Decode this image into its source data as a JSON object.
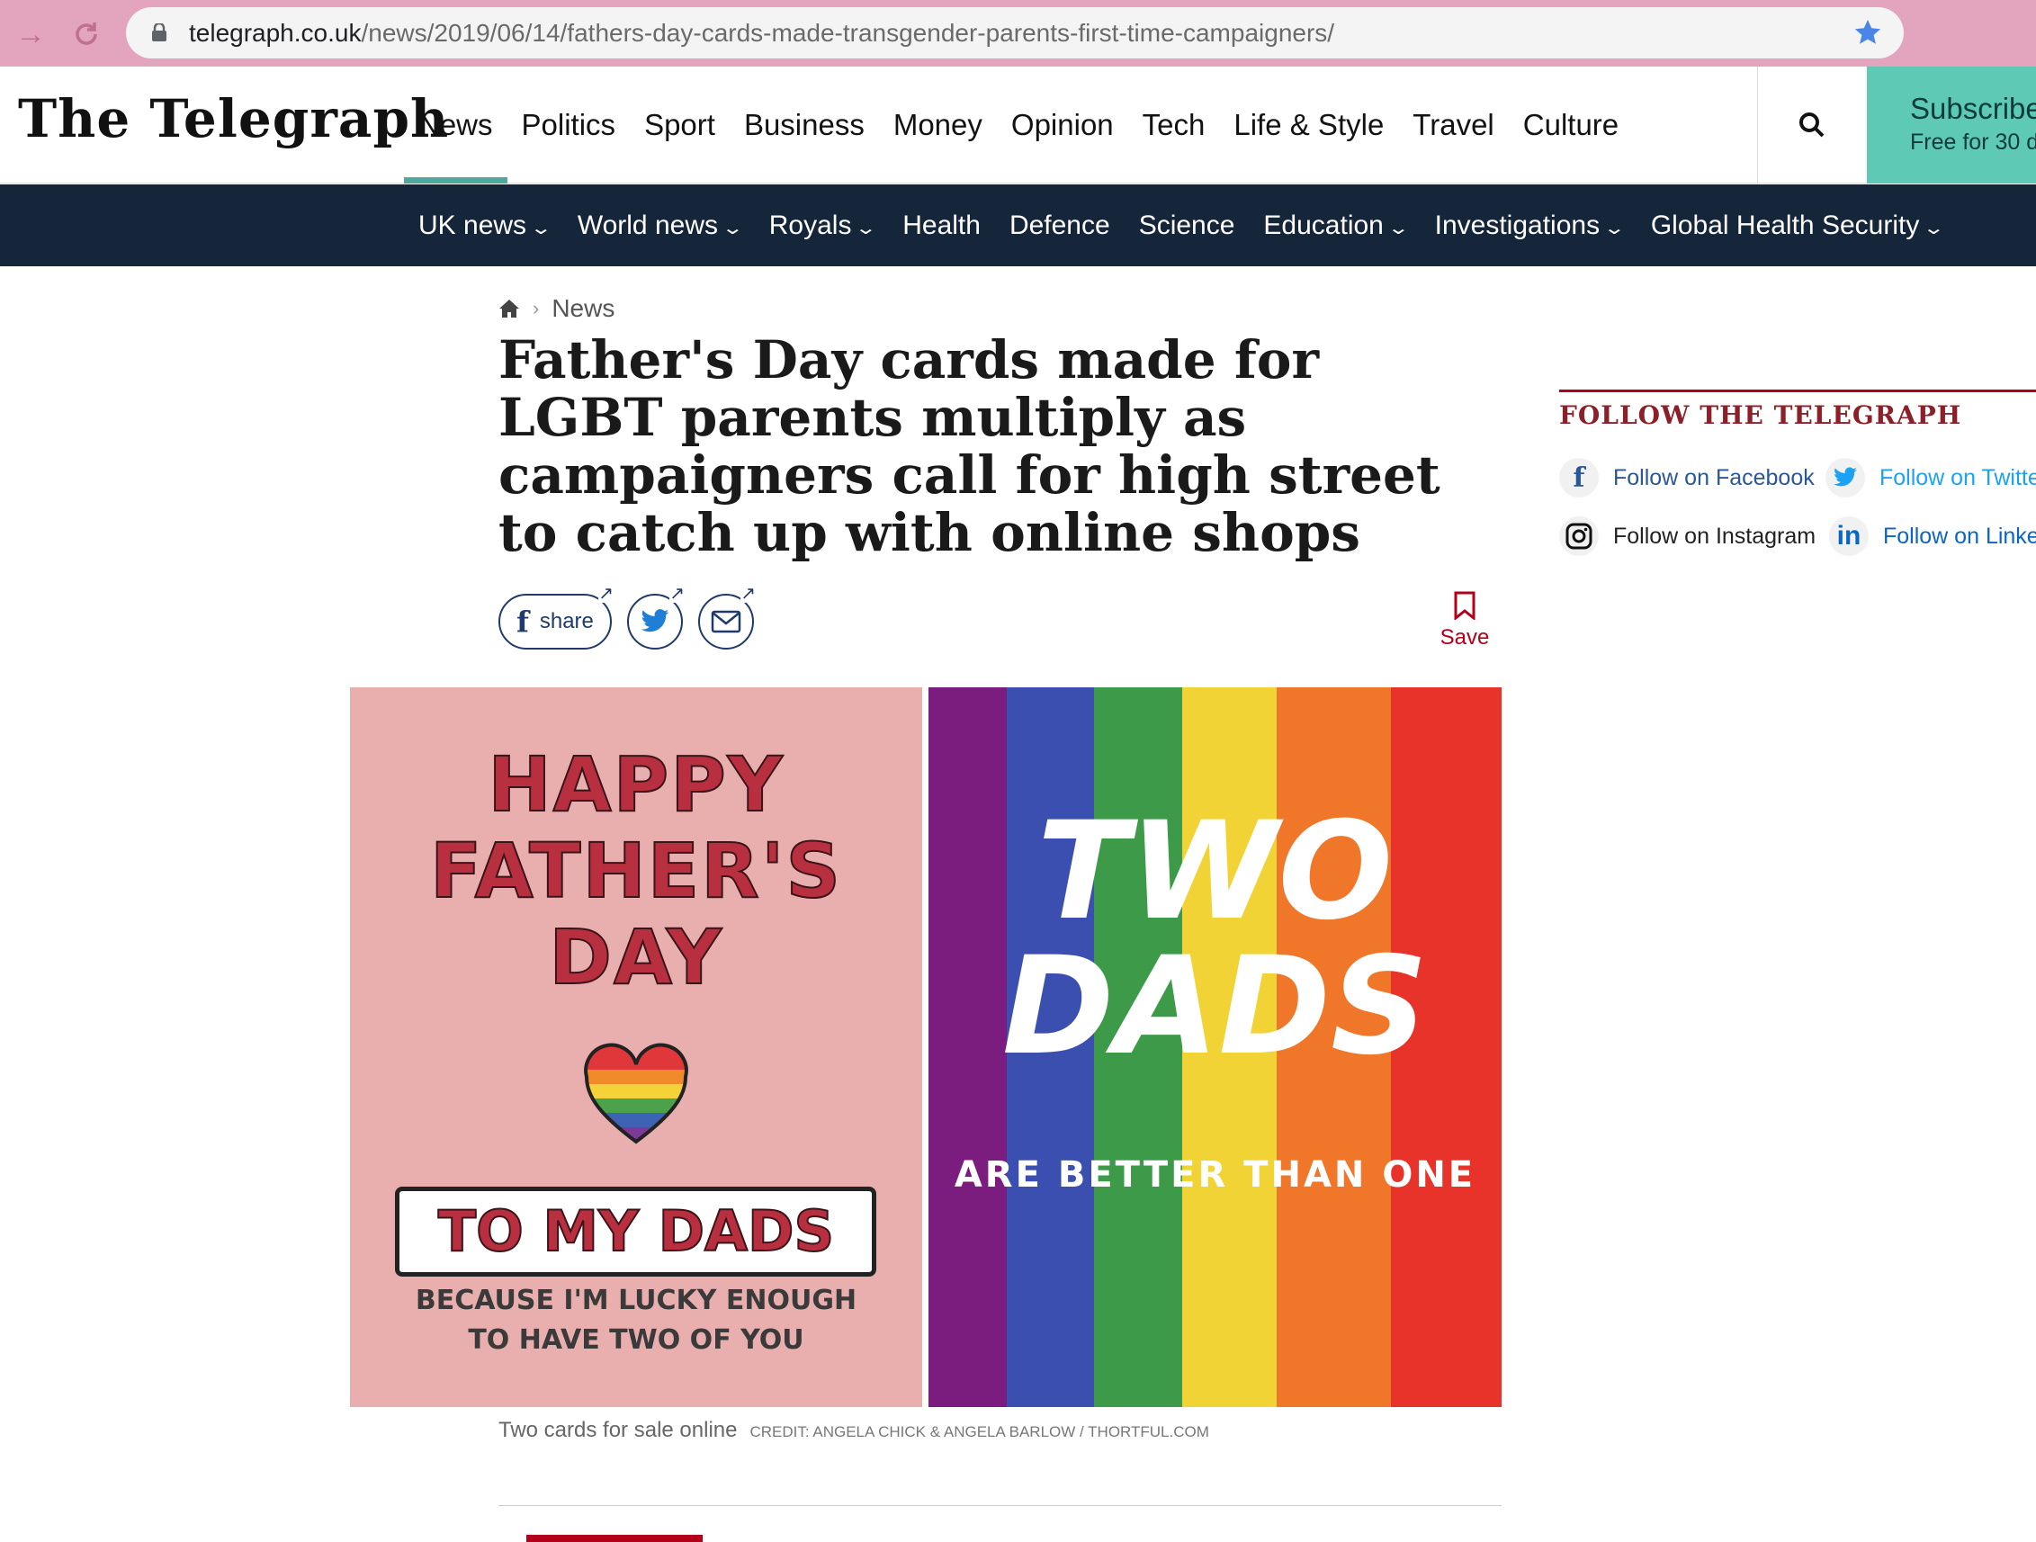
{
  "browser": {
    "url_domain": "telegraph.co.uk",
    "url_path": "/news/2019/06/14/fathers-day-cards-made-transgender-parents-first-time-campaigners/"
  },
  "masthead": {
    "logo": "The Telegraph",
    "nav": [
      "News",
      "Politics",
      "Sport",
      "Business",
      "Money",
      "Opinion",
      "Tech",
      "Life & Style",
      "Travel",
      "Culture"
    ],
    "active_nav": "News",
    "subscribe_title": "Subscribe",
    "subscribe_sub": "Free for 30 d"
  },
  "secondary_nav": {
    "items": [
      {
        "label": "UK news",
        "dropdown": true
      },
      {
        "label": "World news",
        "dropdown": true
      },
      {
        "label": "Royals",
        "dropdown": true
      },
      {
        "label": "Health",
        "dropdown": false
      },
      {
        "label": "Defence",
        "dropdown": false
      },
      {
        "label": "Science",
        "dropdown": false
      },
      {
        "label": "Education",
        "dropdown": true
      },
      {
        "label": "Investigations",
        "dropdown": true
      },
      {
        "label": "Global Health Security",
        "dropdown": true
      }
    ]
  },
  "article": {
    "breadcrumb": "News",
    "headline": "Father's Day cards made for LGBT parents multiply as campaigners call for high street to catch up with online shops",
    "share_label": "share",
    "save_label": "Save",
    "card_left": {
      "line1": "HAPPY",
      "line2": "FATHER'S",
      "line3": "DAY",
      "banner": "TO MY DADS",
      "sub1": "BECAUSE I'M LUCKY ENOUGH",
      "sub2": "TO HAVE TWO OF YOU"
    },
    "card_right": {
      "line1": "TWO",
      "line2": "DADS",
      "sub": "ARE BETTER THAN ONE"
    },
    "caption": "Two cards for sale online",
    "credit": "CREDIT: ANGELA CHICK & ANGELA BARLOW / THORTFUL.COM"
  },
  "sidebar": {
    "title": "FOLLOW THE TELEGRAPH",
    "facebook": "Follow on Facebook",
    "twitter": "Follow on Twitte",
    "instagram": "Follow on Instagram",
    "linkedin": "Follow on Linke"
  },
  "colors": {
    "chrome": "#e3a4bd",
    "accent_teal": "#4fa89c",
    "subscribe": "#5ec9b4",
    "navy": "#15263a",
    "telegraph_red": "#b3001b"
  }
}
